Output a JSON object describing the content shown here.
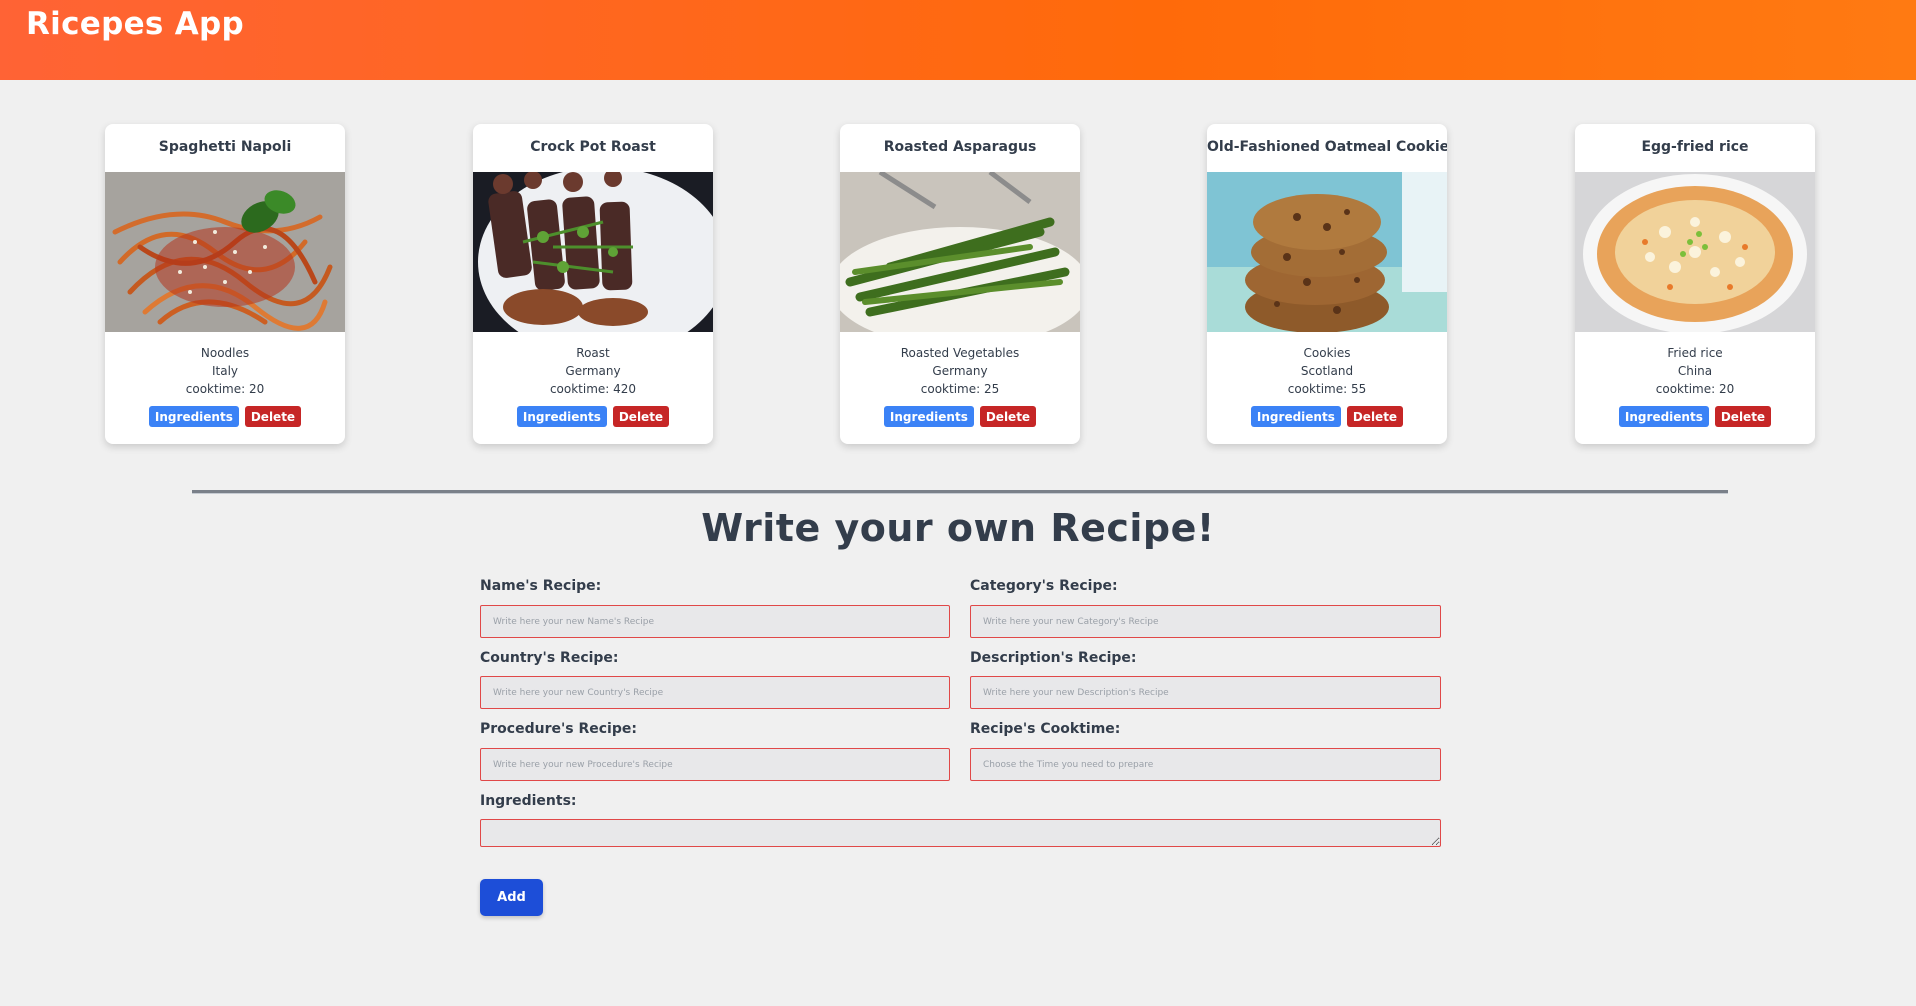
{
  "header": {
    "title": "Ricepes App"
  },
  "recipes": [
    {
      "name": "Spaghetti Napoli",
      "category": "Noodles",
      "country": "Italy",
      "cooktime": "cooktime: 20",
      "ingredients_label": "Ingredients",
      "delete_label": "Delete"
    },
    {
      "name": "Crock Pot Roast",
      "category": "Roast",
      "country": "Germany",
      "cooktime": "cooktime: 420",
      "ingredients_label": "Ingredients",
      "delete_label": "Delete"
    },
    {
      "name": "Roasted Asparagus",
      "category": "Roasted Vegetables",
      "country": "Germany",
      "cooktime": "cooktime: 25",
      "ingredients_label": "Ingredients",
      "delete_label": "Delete"
    },
    {
      "name": "Old-Fashioned Oatmeal Cookies",
      "category": "Cookies",
      "country": "Scotland",
      "cooktime": "cooktime: 55",
      "ingredients_label": "Ingredients",
      "delete_label": "Delete"
    },
    {
      "name": "Egg-fried rice",
      "category": "Fried rice",
      "country": "China",
      "cooktime": "cooktime: 20",
      "ingredients_label": "Ingredients",
      "delete_label": "Delete"
    }
  ],
  "form": {
    "heading": "Write your own Recipe!",
    "name_label": "Name's Recipe:",
    "name_placeholder": "Write here your new Name's Recipe",
    "category_label": "Category's Recipe:",
    "category_placeholder": "Write here your new Category's Recipe",
    "country_label": "Country's Recipe:",
    "country_placeholder": "Write here your new Country's Recipe",
    "description_label": "Description's Recipe:",
    "description_placeholder": "Write here your new Description's Recipe",
    "procedure_label": "Procedure's Recipe:",
    "procedure_placeholder": "Write here your new Procedure's Recipe",
    "cooktime_label": "Recipe's Cooktime:",
    "cooktime_placeholder": "Choose the Time you need to prepare",
    "ingredients_label": "Ingredients:",
    "add_label": "Add"
  },
  "colors": {
    "header_gradient_start": "#ff6335",
    "header_gradient_end": "#ff7a12",
    "ingredients_button": "#3b82f6",
    "delete_button": "#c62626",
    "add_button": "#1d4ed8",
    "input_border": "#e04848"
  }
}
